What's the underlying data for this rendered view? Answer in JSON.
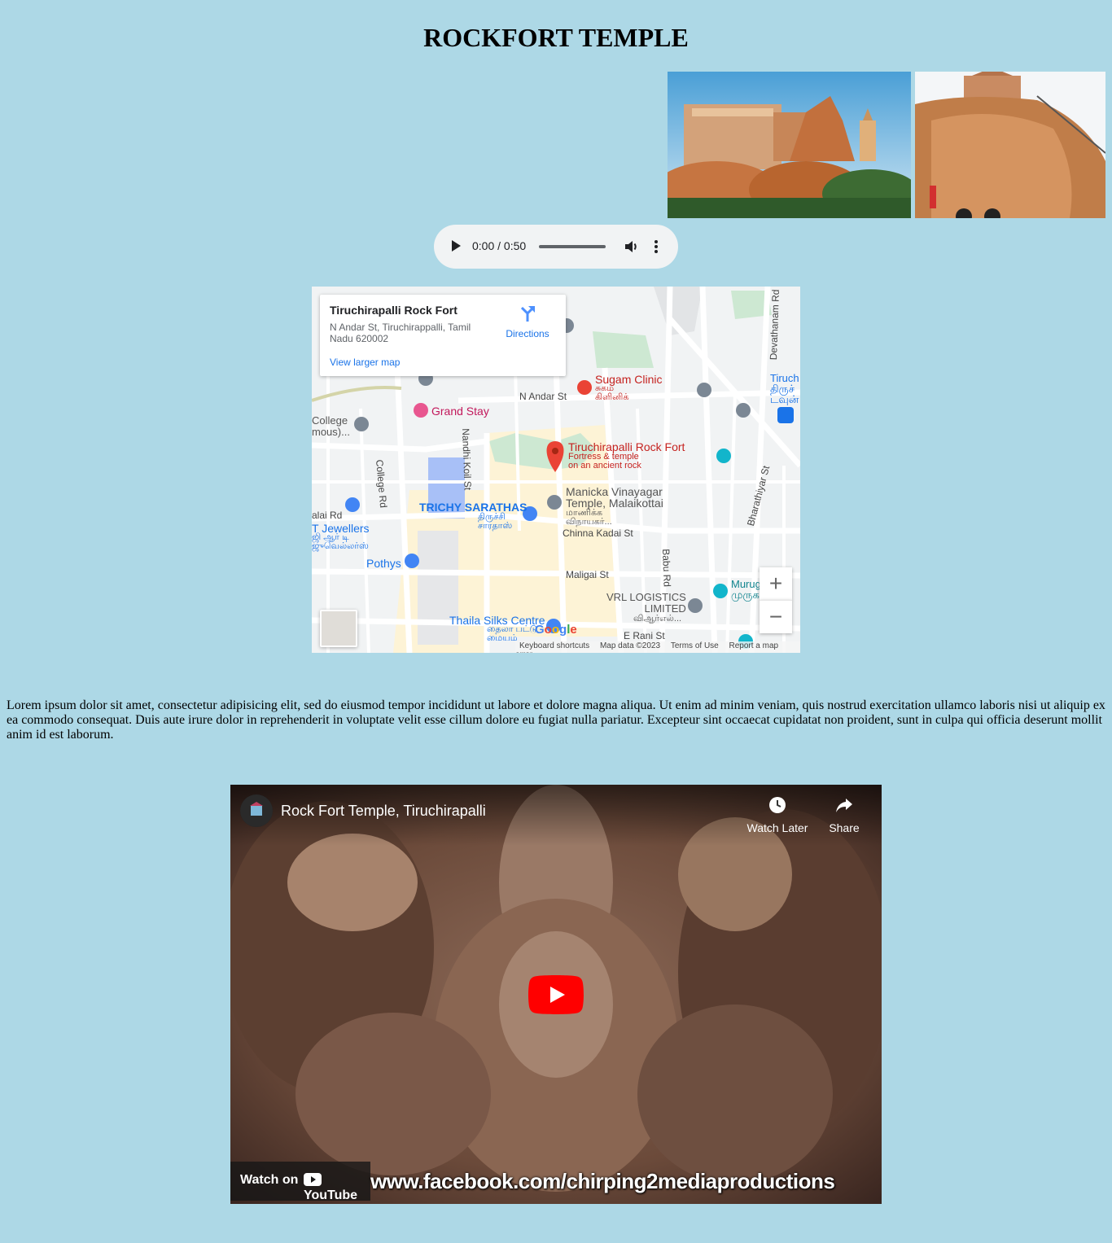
{
  "page": {
    "title": "ROCKFORT TEMPLE"
  },
  "audio": {
    "time": "0:00 / 0:50"
  },
  "map": {
    "place_name": "Tiruchirapalli Rock Fort",
    "address": "N Andar St, Tiruchirappalli, Tamil Nadu 620002",
    "directions_label": "Directions",
    "view_larger": "View larger map",
    "labels": {
      "sugam_clinic": "Sugam Clinic",
      "sugam_clinic_ta": "சுகம்\nகிளினிக்",
      "n_andar": "N Andar St",
      "grand_stay": "Grand Stay",
      "college": "College\nmous)...",
      "college_rd": "College Rd",
      "nandhi": "Nandhi Koil St",
      "rock_fort": "Tiruchirapalli Rock Fort",
      "rock_fort_desc": "Fortress & temple\non an ancient rock",
      "manicka": "Manicka Vinayagar\nTemple, Malaikottai",
      "manicka_ta": "மாணிக்க\nவிநாயகர்...",
      "trichy_sarathas": "TRICHY SARATHAS",
      "trichy_sarathas_ta": "திருச்சி\nசாரதாஸ்",
      "chinna_kadai": "Chinna Kadai St",
      "jewellers": "T Jewellers",
      "jewellers_ta": "ஜி ஆர் டி\nஜுவெல்லர்ஸ்",
      "salai_rd": "alai Rd",
      "pothys": "Pothys",
      "maligai": "Maligai St",
      "babu_rd": "Babu Rd",
      "vrl": "VRL LOGISTICS\nLIMITED",
      "vrl_ta": "விஆர்எல்...",
      "thaila": "Thaila Silks Centre",
      "thaila_ta": "தைலா பட்டு\nமையம்",
      "e_rani": "E Rani St",
      "bharathiyar": "Bharathiyar St",
      "devathanam": "Devathanam Rd",
      "tiruch": "Tiruch\nதிருச்\nடவுன்",
      "murug": "Murug\nமுருக"
    },
    "footer": [
      "Keyboard shortcuts",
      "Map data ©2023",
      "Terms of Use",
      "Report a map error"
    ],
    "google": "Google"
  },
  "content": {
    "paragraph": "Lorem ipsum dolor sit amet, consectetur adipisicing elit, sed do eiusmod tempor incididunt ut labore et dolore magna aliqua. Ut enim ad minim veniam, quis nostrud exercitation ullamco laboris nisi ut aliquip ex ea commodo consequat. Duis aute irure dolor in reprehenderit in voluptate velit esse cillum dolore eu fugiat nulla pariatur. Excepteur sint occaecat cupidatat non proident, sunt in culpa qui officia deserunt mollit anim id est laborum."
  },
  "video": {
    "title": "Rock Fort Temple, Tiruchirapalli",
    "watch_later": "Watch Later",
    "share": "Share",
    "watch_on": "Watch on",
    "youtube": "YouTube",
    "overlay_text": "www.facebook.com/chirping2mediaproductions"
  }
}
